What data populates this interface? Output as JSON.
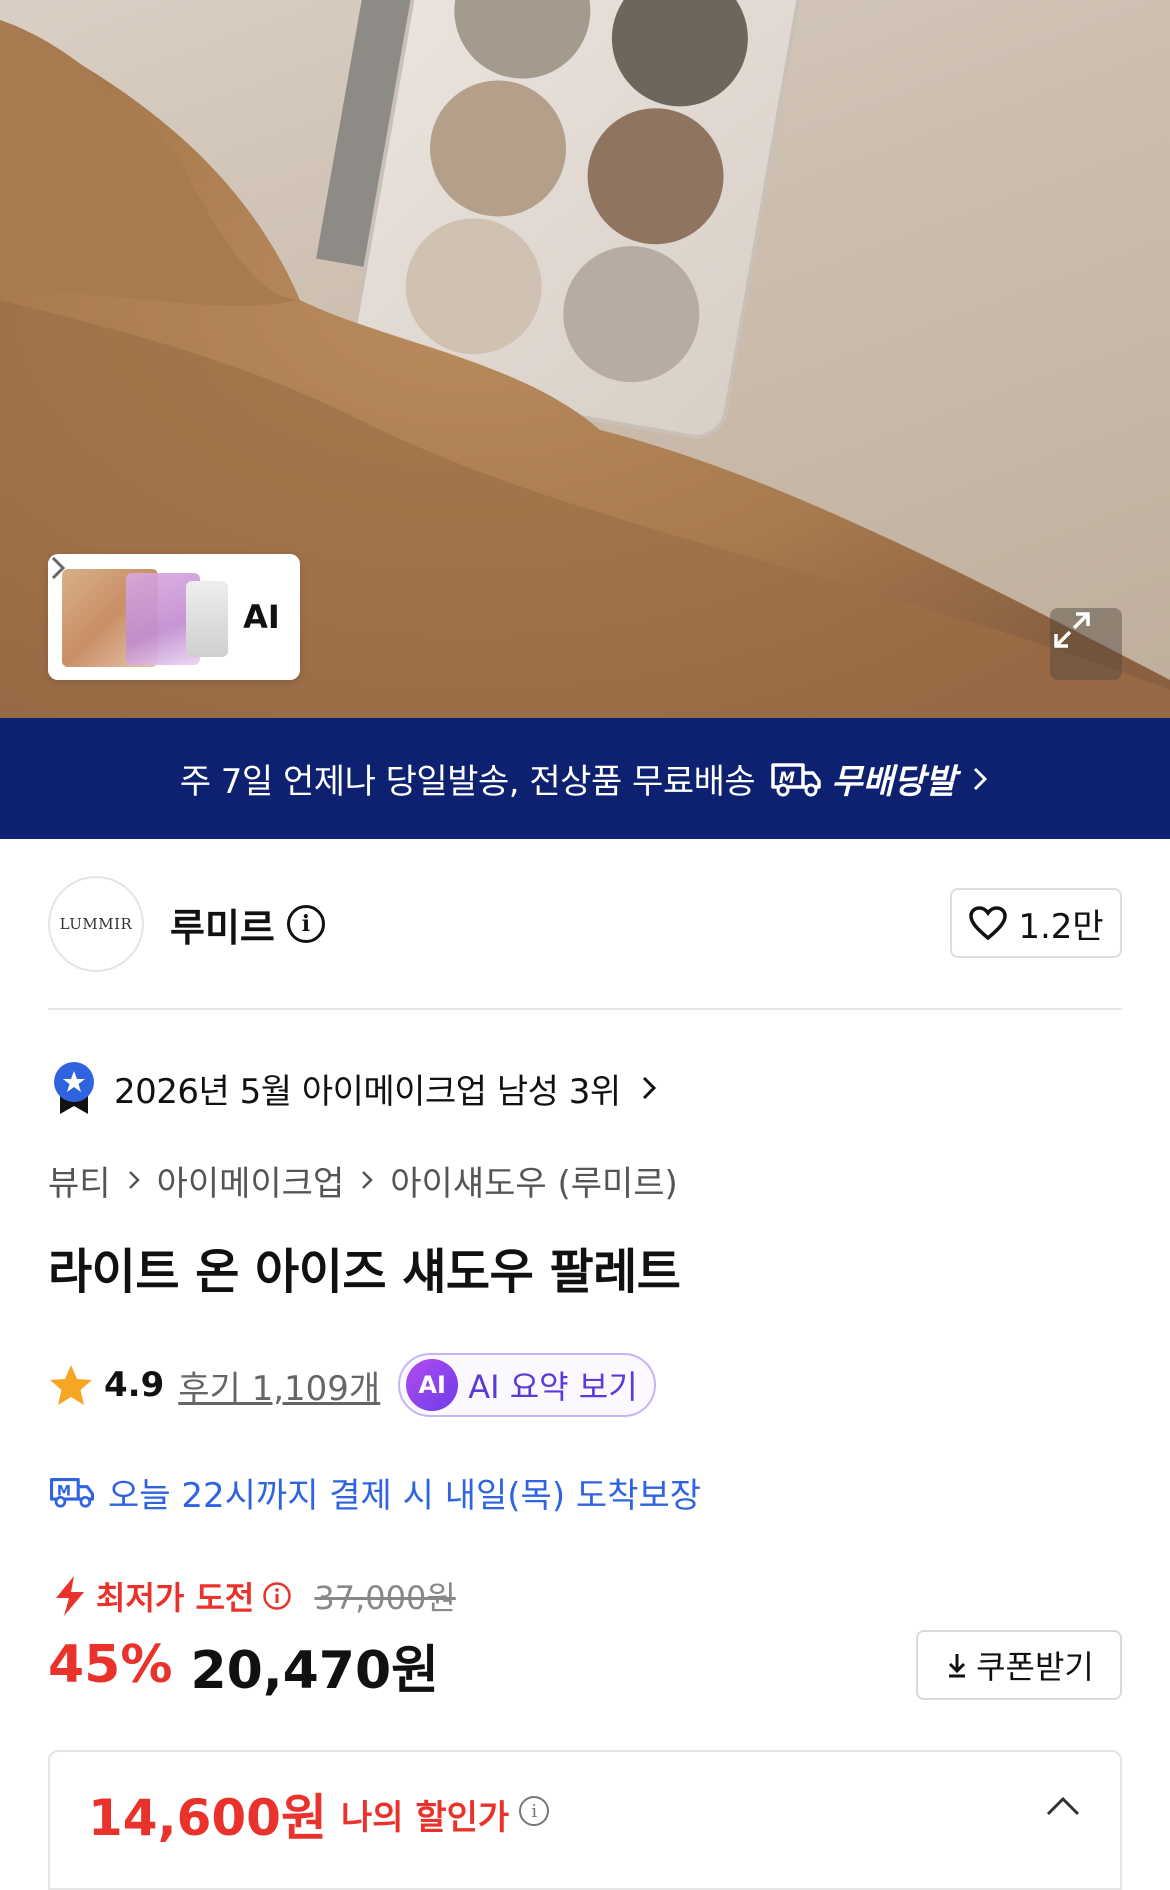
{
  "hero": {
    "ai_label": "AI"
  },
  "banner": {
    "text": "주 7일 언제나 당일발송, 전상품 무료배송",
    "brand": "무배당발"
  },
  "seller": {
    "logo_text": "LUMMIR",
    "name": "루미르",
    "likes": "1.2만"
  },
  "ranking": {
    "text": "2026년 5월 아이메이크업 남성 3위"
  },
  "breadcrumb": [
    "뷰티",
    "아이메이크업",
    "아이섀도우 (루미르)"
  ],
  "product": {
    "title": "라이트 온 아이즈 섀도우 팔레트",
    "rating": "4.9",
    "reviews": "후기 1,109개",
    "ai_badge": "AI",
    "ai_summary": "AI 요약 보기",
    "delivery": "오늘 22시까지 결제 시 내일(목) 도착보장"
  },
  "price": {
    "promo_label": "최저가 도전",
    "original": "37,000원",
    "discount": "45%",
    "current": "20,470원",
    "coupon_button": "쿠폰받기",
    "my_price": "14,600원",
    "my_price_label": "나의 할인가"
  },
  "colors": {
    "banner_bg": "#0d2170",
    "sale_red": "#e8322b",
    "delivery_blue": "#2f63e0",
    "ai_purple": "#5b3bd8"
  }
}
